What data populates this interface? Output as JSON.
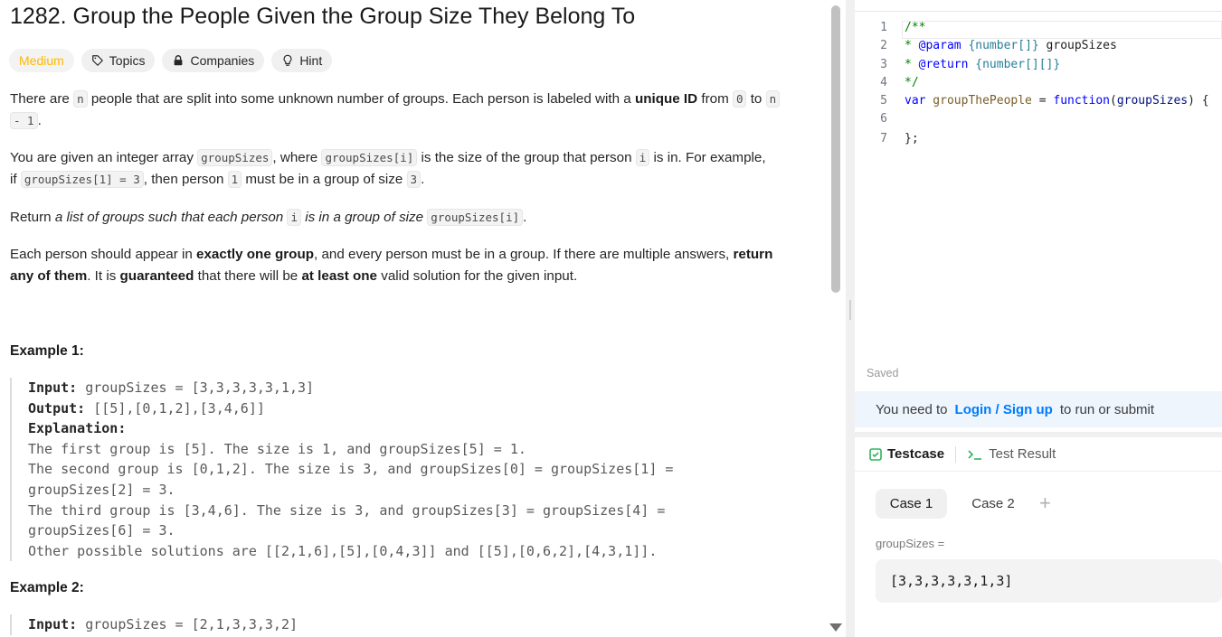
{
  "problem": {
    "title": "1282. Group the People Given the Group Size They Belong To",
    "difficulty": "Medium",
    "tags": {
      "topics": "Topics",
      "companies": "Companies",
      "hint": "Hint"
    },
    "para1": {
      "a": "There are ",
      "code_n": "n",
      "b": " people that are split into some unknown number of groups. Each person is labeled with a ",
      "bold": "unique ID",
      "c": " from ",
      "code_0": "0",
      "d": " to ",
      "code_n2": "n",
      "code_n1": "- 1",
      "e": "."
    },
    "para2": {
      "a": "You are given an integer array ",
      "code_gs": "groupSizes",
      "b": ", where ",
      "code_gsi": "groupSizes[i]",
      "c": " is the size of the group that person ",
      "code_i": "i",
      "d": " is in. For example,",
      "e": "if ",
      "code_ex": "groupSizes[1] = 3",
      "f": ", then person ",
      "code_1": "1",
      "g": " must be in a group of size ",
      "code_3": "3",
      "h": "."
    },
    "para3": {
      "a": "Return ",
      "i1": "a list of groups such that each person ",
      "code_i": "i",
      "i2": " is in a group of size ",
      "code_gsi": "groupSizes[i]",
      "b": "."
    },
    "para4": {
      "a": "Each person should appear in ",
      "b1": "exactly one group",
      "b": ", and every person must be in a group. If there are multiple answers, ",
      "b2": "return",
      "c": "any of them",
      "d": ". It is ",
      "b3": "guaranteed",
      "e": " that there will be ",
      "b4": "at least one",
      "f": " valid solution for the given input."
    },
    "example1": {
      "heading": "Example 1:",
      "input_label": "Input:",
      "input_value": " groupSizes = [3,3,3,3,3,1,3]",
      "output_label": "Output:",
      "output_value": " [[5],[0,1,2],[3,4,6]]",
      "explanation_label": "Explanation:",
      "lines": [
        "The first group is [5]. The size is 1, and groupSizes[5] = 1.",
        "The second group is [0,1,2]. The size is 3, and groupSizes[0] = groupSizes[1] =",
        "groupSizes[2] = 3.",
        "The third group is [3,4,6]. The size is 3, and groupSizes[3] = groupSizes[4] =",
        "groupSizes[6] = 3.",
        "Other possible solutions are [[2,1,6],[5],[0,4,3]] and [[5],[0,6,2],[4,3,1]]."
      ]
    },
    "example2": {
      "heading": "Example 2:",
      "input_label": "Input:",
      "input_value": " groupSizes = [2,1,3,3,3,2]"
    }
  },
  "editor": {
    "lines": [
      {
        "n": "1",
        "t1": "/**"
      },
      {
        "n": "2",
        "t1": " * ",
        "t2": "@param",
        "t3": " {number[]}",
        "t4": " groupSizes"
      },
      {
        "n": "3",
        "t1": " * ",
        "t2": "@return",
        "t3": " {number[][]}"
      },
      {
        "n": "4",
        "t1": " */"
      },
      {
        "n": "5",
        "kw": "var",
        "fn": " groupThePeople",
        "op": " = ",
        "kw2": "function",
        "p1": "(",
        "vr": "groupSizes",
        "p2": ") {"
      },
      {
        "n": "6"
      },
      {
        "n": "7",
        "t": "};"
      }
    ],
    "saved": "Saved"
  },
  "login": {
    "prefix": "You need to",
    "link": "Login / Sign up",
    "suffix": "to run or submit"
  },
  "testcase": {
    "tab_testcase": "Testcase",
    "tab_result": "Test Result",
    "case1": "Case 1",
    "case2": "Case 2",
    "plus": "+",
    "param_label": "groupSizes =",
    "param_value": "[3,3,3,3,3,1,3]"
  },
  "colors": {
    "accent": "#007bff",
    "medium": "#ffb800",
    "success": "#2db55d"
  }
}
